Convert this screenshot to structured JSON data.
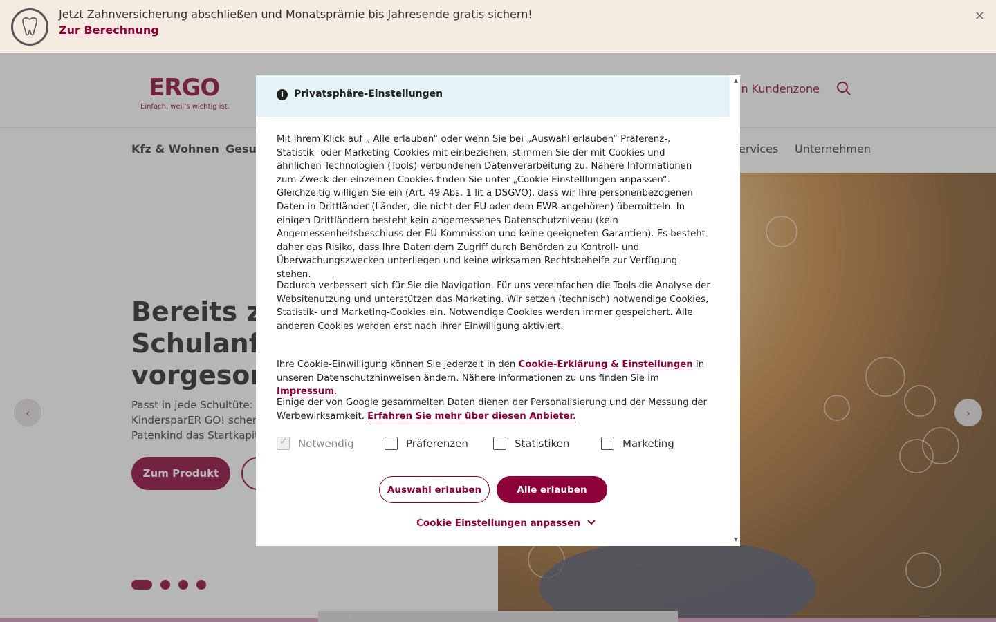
{
  "banner": {
    "text": "Jetzt Zahnversicherung abschließen und Monatsprämie bis Jahresende gratis sichern!",
    "link": "Zur Berechnung",
    "close": "×"
  },
  "header": {
    "logo": "ERGO",
    "tagline": "Einfach, weil’s wichtig ist.",
    "kundenzone": "in Kundenzone"
  },
  "nav": {
    "items": [
      "Kfz & Wohnen",
      "Gesun",
      "ervices",
      "Unternehmen"
    ]
  },
  "hero": {
    "title_lines": [
      "Bereits zu",
      "Schulanfa",
      "vorgesorg"
    ],
    "sub_lines": [
      "Passt in jede Schultüte: M",
      "KindersparER GO! schenk",
      "Patenkind das Startkapita"
    ],
    "btn_produkt": "Zum Produkt",
    "prev": "‹",
    "next": "›"
  },
  "modal": {
    "title": "Privatsphäre-Einstellungen",
    "p1": "Mit Ihrem Klick auf „ Alle erlauben“ oder wenn Sie bei „Auswahl erlauben“ Präferenz-, Statistik- oder Marketing-Cookies mit einbeziehen, stimmen Sie der mit Cookies und ähnlichen Technologien (Tools) verbundenen Datenverarbeitung zu. Nähere Informationen zum Zweck der einzelnen Cookies finden Sie unter „Cookie Einstelllungen anpassen“. Gleichzeitig willigen Sie ein (Art. 49 Abs. 1 lit a DSGVO), dass wir Ihre personenbezogenen Daten in Drittländer (Länder, die nicht der EU oder dem EWR angehören) übermitteln. In einigen Drittländern besteht kein angemessenes Datenschutzniveau (kein Angemessenheitsbeschluss der EU-Kommission und keine geeigneten Garantien). Es besteht daher das Risiko, dass Ihre Daten dem Zugriff durch Behörden zu Kontroll- und Überwachungszwecken unterliegen und keine wirksamen Rechtsbehelfe zur Verfügung stehen.",
    "p2": "Dadurch verbessert sich für Sie die Navigation. Für uns vereinfachen die Tools die Analyse der Websitenutzung und unterstützen das Marketing. Wir setzen (technisch) notwendige Cookies, Statistik- und Marketing-Cookies ein. Notwendige Cookies werden immer gespeichert. Alle anderen Cookies werden erst nach Ihrer Einwilligung aktiviert.",
    "p3_a": "Ihre Cookie-Einwilligung können Sie jederzeit in den ",
    "p3_link1": "Cookie-Erklärung & Einstellungen",
    "p3_b": " in unseren Datenschutzhinweisen ändern. Nähere Informationen zu uns finden Sie im ",
    "p3_link2": "Impressum",
    "p3_c": ".",
    "p4_a": "Einige der von Google gesammelten Daten dienen der Personalisierung und der Messung der Werbewirksamkeit. ",
    "p4_link": "Erfahren Sie mehr über diesen Anbieter.",
    "checkboxes": [
      "Notwendig",
      "Präferenzen",
      "Statistiken",
      "Marketing"
    ],
    "btn_auswahl": "Auswahl erlauben",
    "btn_alle": "Alle erlauben",
    "adjust": "Cookie Einstellungen anpassen"
  },
  "colors": {
    "brand": "#8e0038",
    "banner_bg": "#f6ebe0",
    "modal_head_bg": "#e3f3f6"
  }
}
